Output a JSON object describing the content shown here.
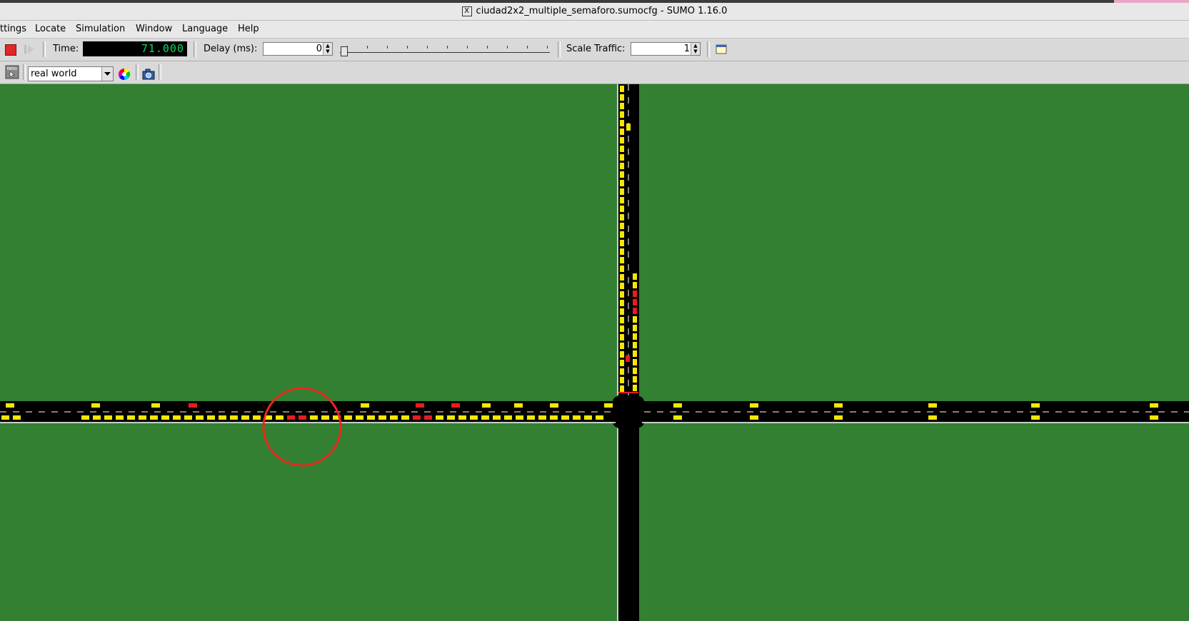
{
  "window": {
    "title": "ciudad2x2_multiple_semaforo.sumocfg - SUMO 1.16.0",
    "x_glyph": "X"
  },
  "menu": {
    "items": [
      "ttings",
      "Locate",
      "Simulation",
      "Window",
      "Language",
      "Help"
    ]
  },
  "toolbar": {
    "time_label": "Time:",
    "time_value": "71.000",
    "delay_label": "Delay (ms):",
    "delay_value": "0",
    "scale_label": "Scale Traffic:",
    "scale_value": "1",
    "delay_slider_fraction": 0
  },
  "view": {
    "scheme": "real world",
    "menu_icon_text": "MENU"
  },
  "colors": {
    "grass": "#338033",
    "road": "#000000",
    "vehicle": "#f7e600",
    "vehicle_braking": "#e81c1c",
    "annotation_circle": "#e8291c",
    "time_digits": "#0fd85a"
  },
  "icons": [
    "stop-icon",
    "step-icon",
    "menu-icon",
    "color-wheel-icon",
    "camera-icon",
    "dock-icon"
  ]
}
